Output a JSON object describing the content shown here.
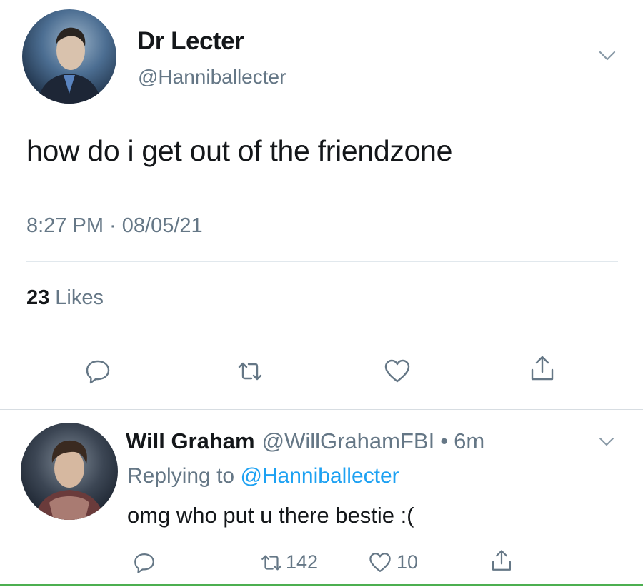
{
  "main_tweet": {
    "display_name": "Dr Lecter",
    "handle": "@Hanniballecter",
    "text": "how do i get out of the friendzone",
    "timestamp": "8:27 PM · 08/05/21",
    "likes_count": "23",
    "likes_label": "Likes",
    "icons": {
      "reply": "reply-icon",
      "retweet": "retweet-icon",
      "like": "heart-icon",
      "share": "share-icon",
      "menu": "chevron-down-icon"
    }
  },
  "reply_tweet": {
    "display_name": "Will Graham",
    "handle": "@WillGrahamFBI",
    "separator": "•",
    "time_ago": "6m",
    "replying_prefix": "Replying to",
    "replying_to": "@Hanniballecter",
    "text": "omg who put u there bestie :(",
    "retweet_count": "142",
    "like_count": "10"
  },
  "colors": {
    "text_primary": "#14171a",
    "text_secondary": "#657786",
    "link": "#1da1f2",
    "divider": "#e1e8ed"
  }
}
